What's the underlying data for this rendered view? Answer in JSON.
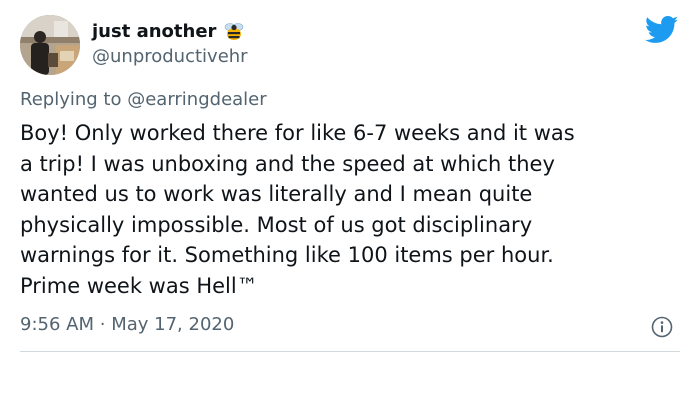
{
  "author": {
    "display_name": "just another",
    "handle": "@unproductivehr",
    "name_emoji_icon": "bee-icon"
  },
  "reply": {
    "prefix": "Replying to",
    "mention": "@earringdealer"
  },
  "tweet": {
    "text": "Boy! Only worked there for like 6-7 weeks and it was\na trip! I was unboxing and the speed at which they\nwanted us to work was literally and I mean quite\nphysically impossible. Most of us got disciplinary\nwarnings for it. Something like 100 items per hour.\nPrime week was Hell™",
    "time": "9:56 AM",
    "separator": "·",
    "date": "May 17, 2020"
  },
  "icons": {
    "logo": "twitter-bird-icon",
    "info": "info-icon"
  },
  "colors": {
    "brand_blue": "#1d9bf0",
    "text_primary": "#0f1419",
    "text_secondary": "#536471",
    "divider": "#cfd9de"
  }
}
